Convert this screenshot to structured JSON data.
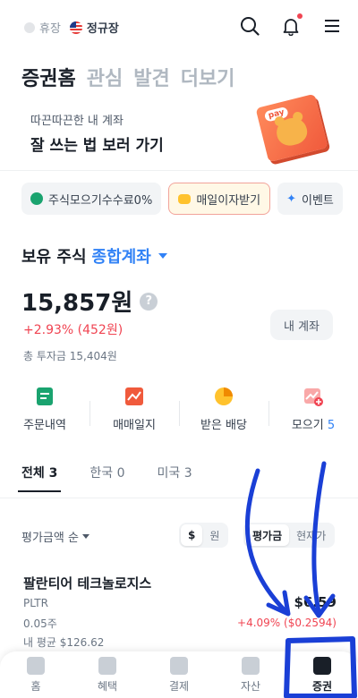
{
  "status_bar": {
    "market_closed": "휴장",
    "market_regular": "정규장"
  },
  "top_icons": [
    "search-icon",
    "bell-icon",
    "menu-icon"
  ],
  "main_tabs": [
    {
      "label": "증권홈",
      "active": true
    },
    {
      "label": "관심",
      "active": false
    },
    {
      "label": "발견",
      "active": false
    },
    {
      "label": "더보기",
      "active": false
    }
  ],
  "promo": {
    "subtitle": "따끈따끈한 내 계좌",
    "title": "잘 쓰는 법 보러 가기",
    "badge": "pay"
  },
  "chips": [
    {
      "label": "주식모으기수수료0%",
      "icon": "percent-icon"
    },
    {
      "label": "매일이자받기",
      "icon": "coin-icon"
    },
    {
      "label": "이벤트",
      "icon": "party-icon"
    }
  ],
  "holdings": {
    "heading": "보유 주식",
    "account_type": "종합계좌",
    "total_value": "15,857원",
    "total_gain": "+2.93% (452원)",
    "my_account_button": "내 계좌",
    "total_invested": "총 투자금 15,404원"
  },
  "quick_actions": [
    {
      "label": "주문내역",
      "icon": "order-list-icon",
      "color": "#1aa36f"
    },
    {
      "label": "매매일지",
      "icon": "trade-journal-icon",
      "color": "#f05a3c"
    },
    {
      "label": "받은 배당",
      "icon": "dividend-icon",
      "color": "#ffc22d"
    },
    {
      "label": "모으기",
      "count": "5",
      "icon": "collect-icon",
      "color": "#f04452"
    }
  ],
  "holding_tabs": [
    {
      "label": "전체 3",
      "active": true
    },
    {
      "label": "한국 0",
      "active": false
    },
    {
      "label": "미국 3",
      "active": false
    }
  ],
  "sort": {
    "label": "평가금액 순",
    "currency_options": [
      "$",
      "원"
    ],
    "currency_selected": "$",
    "view_options": [
      "평가금",
      "현재가"
    ],
    "view_selected": "평가금"
  },
  "stock": {
    "name": "팔란티어 테크놀로지스",
    "ticker": "PLTR",
    "quantity": "0.05주",
    "average": "내 평균 $126.62",
    "value": "$6.59",
    "change": "+4.09% ($0.2594)"
  },
  "bottom_nav": [
    {
      "label": "홈",
      "icon": "home-icon",
      "active": false
    },
    {
      "label": "혜택",
      "icon": "gift-icon",
      "active": false
    },
    {
      "label": "결제",
      "icon": "scan-icon",
      "active": false
    },
    {
      "label": "자산",
      "icon": "wallet-icon",
      "active": false
    },
    {
      "label": "증권",
      "icon": "chart-icon",
      "active": true
    }
  ],
  "colors": {
    "accent": "#3182f6",
    "gain": "#f04452",
    "annotation": "#1a3fd6"
  }
}
